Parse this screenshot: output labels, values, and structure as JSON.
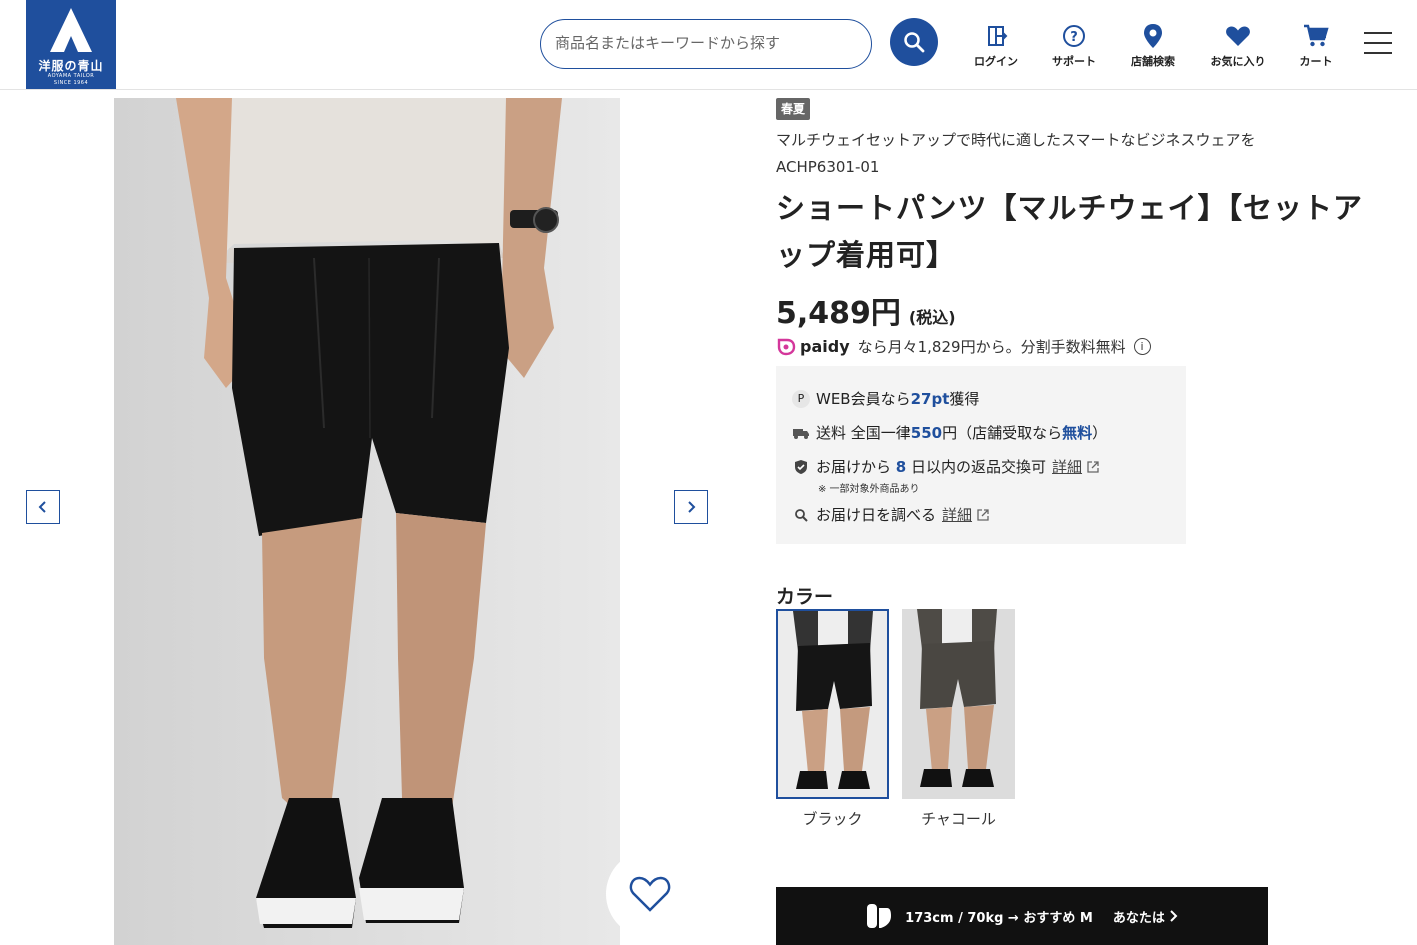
{
  "header": {
    "logo": {
      "title": "洋服の青山",
      "sub": "AOYAMA TAILOR",
      "since": "SINCE 1964"
    },
    "search": {
      "placeholder": "商品名またはキーワードから探す"
    },
    "nav": [
      {
        "label": "ログイン",
        "icon": "login-icon"
      },
      {
        "label": "サポート",
        "icon": "help-icon"
      },
      {
        "label": "店舗検索",
        "icon": "location-pin-icon"
      },
      {
        "label": "お気に入り",
        "icon": "heart-icon"
      },
      {
        "label": "カート",
        "icon": "cart-icon"
      }
    ]
  },
  "product": {
    "season_badge": "春夏",
    "catch_copy": "マルチウェイセットアップで時代に適したスマートなビジネスウェアを",
    "code": "ACHP6301-01",
    "title": "ショートパンツ【マルチウェイ】【セットアップ着用可】",
    "price": "5,489円",
    "tax_label": "(税込)",
    "paidy": {
      "brand": "paidy",
      "text": "なら月々1,829円から。分割手数料無料"
    },
    "info": {
      "points_pre": "WEB会員なら",
      "points_value": "27pt",
      "points_post": "獲得",
      "shipping_pre": "送料 全国一律",
      "shipping_value": "550",
      "shipping_mid": "円（店舗受取なら",
      "shipping_free": "無料",
      "shipping_post": "）",
      "return_pre": "お届けから",
      "return_days": "8",
      "return_post": "日以内の返品交換可",
      "return_link": "詳細",
      "return_note": "※ 一部対象外商品あり",
      "delivery_text": "お届け日を調べる",
      "delivery_link": "詳細"
    },
    "color_title": "カラー",
    "colors": [
      {
        "name": "ブラック",
        "selected": true,
        "hex": "#151515"
      },
      {
        "name": "チャコール",
        "selected": false,
        "hex": "#4a4742"
      }
    ],
    "fit_bar": {
      "text": "173cm / 70kg → おすすめ M",
      "you": "あなたは"
    }
  },
  "colors": {
    "brand": "#1f4f9d",
    "paidy_pink": "#d4379b"
  }
}
